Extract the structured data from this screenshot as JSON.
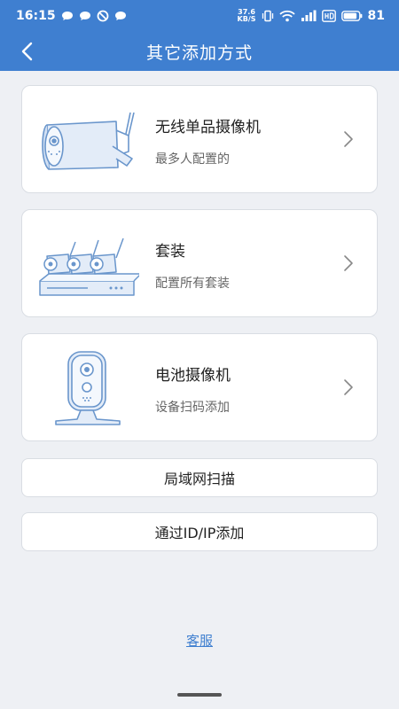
{
  "status": {
    "time": "16:15",
    "net_speed_top": "37.6",
    "net_speed_bottom": "KB/S",
    "battery": "81"
  },
  "header": {
    "title": "其它添加方式"
  },
  "options": [
    {
      "title": "无线单品摄像机",
      "subtitle": "最多人配置的",
      "icon": "bullet-camera-icon"
    },
    {
      "title": "套装",
      "subtitle": "配置所有套装",
      "icon": "nvr-kit-icon"
    },
    {
      "title": "电池摄像机",
      "subtitle": "设备扫码添加",
      "icon": "battery-camera-icon"
    }
  ],
  "buttons": {
    "lan_scan": "局域网扫描",
    "add_by_id": "通过ID/IP添加"
  },
  "footer": {
    "support": "客服"
  },
  "colors": {
    "accent": "#3f7fd0",
    "background": "#eef0f4",
    "icon_stroke": "#6a96cc",
    "icon_fill": "#e3ecf8"
  }
}
